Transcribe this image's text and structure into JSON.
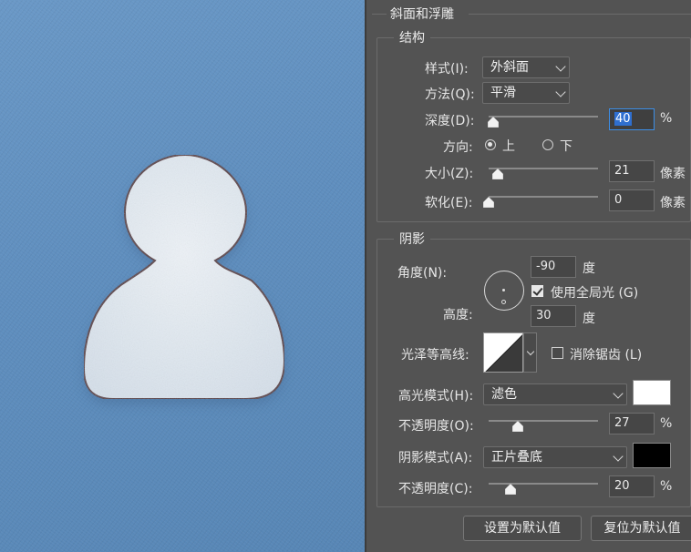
{
  "panel": {
    "section_title": "斜面和浮雕",
    "structure": {
      "title": "结构",
      "style_label": "样式(I):",
      "style_value": "外斜面",
      "technique_label": "方法(Q):",
      "technique_value": "平滑",
      "depth_label": "深度(D):",
      "depth_value": "40",
      "depth_unit": "%",
      "depth_slider": 0.04,
      "direction_label": "方向:",
      "direction_up": "上",
      "direction_down": "下",
      "direction_selected": "上",
      "size_label": "大小(Z):",
      "size_value": "21",
      "size_unit": "像素",
      "size_slider": 0.085,
      "soften_label": "软化(E):",
      "soften_value": "0",
      "soften_unit": "像素",
      "soften_slider": 0.0
    },
    "shading": {
      "title": "阴影",
      "angle_label": "角度(N):",
      "angle_value": "-90",
      "angle_unit": "度",
      "global_light_label": "使用全局光 (G)",
      "global_light_checked": true,
      "altitude_label": "高度:",
      "altitude_value": "30",
      "altitude_unit": "度",
      "gloss_contour_label": "光泽等高线:",
      "anti_aliased_label": "消除锯齿 (L)",
      "anti_aliased_checked": false,
      "highlight_mode_label": "高光模式(H):",
      "highlight_mode_value": "滤色",
      "highlight_color": "#ffffff",
      "highlight_opacity_label": "不透明度(O):",
      "highlight_opacity_value": "27",
      "highlight_opacity_unit": "%",
      "highlight_opacity_slider": 0.27,
      "shadow_mode_label": "阴影模式(A):",
      "shadow_mode_value": "正片叠底",
      "shadow_color": "#000000",
      "shadow_opacity_label": "不透明度(C):",
      "shadow_opacity_value": "20",
      "shadow_opacity_unit": "%",
      "shadow_opacity_slider": 0.2
    },
    "buttons": {
      "make_default": "设置为默认值",
      "reset_default": "复位为默认值"
    }
  },
  "colors": {
    "canvas_blue": "#6392c1",
    "panel_bg": "#535353",
    "figure_fill": "#e2e9f1",
    "figure_outline": "#5a4046"
  },
  "icons": {
    "dropdown": "chevron-down-icon",
    "person": "person-silhouette-icon"
  }
}
